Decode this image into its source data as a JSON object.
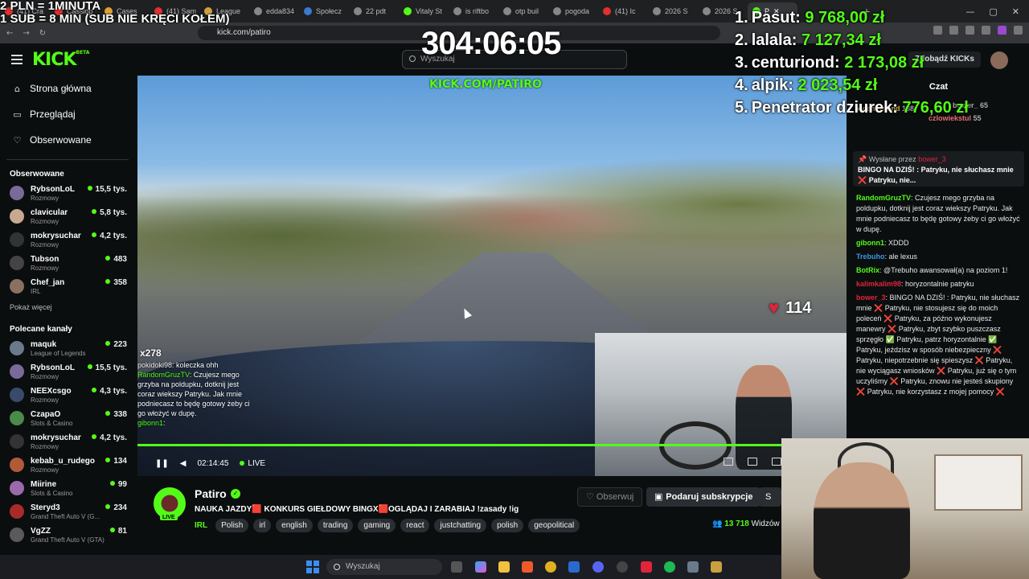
{
  "browser": {
    "tabs": [
      {
        "title": "(41) Cra",
        "color": "#e03030"
      },
      {
        "title": "Cassiop",
        "color": "#e03030"
      },
      {
        "title": "Cases",
        "color": "#e0a030"
      },
      {
        "title": "(41) Sam",
        "color": "#e03030"
      },
      {
        "title": "League",
        "color": "#d0a040"
      },
      {
        "title": "edda834",
        "color": "#888888"
      },
      {
        "title": "Społecz",
        "color": "#3a7ad0"
      },
      {
        "title": "22 pdt",
        "color": "#888888"
      },
      {
        "title": "Vitaly St",
        "color": "#53fc18"
      },
      {
        "title": "is riftbo",
        "color": "#888888"
      },
      {
        "title": "otp buil",
        "color": "#888888"
      },
      {
        "title": "pogoda",
        "color": "#888888"
      },
      {
        "title": "(41) Ic",
        "color": "#e03030"
      },
      {
        "title": "2026 S",
        "color": "#888888"
      },
      {
        "title": "2026 S",
        "color": "#888888"
      },
      {
        "title": "P",
        "color": "#53fc18"
      }
    ],
    "url": "kick.com/patiro",
    "window_controls": {
      "minimize": "—",
      "maximize": "▢",
      "close": "✕"
    },
    "new_tab": "+",
    "close_tab": "✕"
  },
  "overlay": {
    "line1": "2 PLN =  1MINUTA",
    "line2": "1 SUB = 8 MIN (SUB NIE KRĘCI KOŁEM)",
    "timer": "304:06:05",
    "leaderboard": [
      {
        "rank": "1.",
        "name": "Pasut:",
        "amount": "9 768,00 zł"
      },
      {
        "rank": "2.",
        "name": "lalala:",
        "amount": "7 127,34 zł"
      },
      {
        "rank": "3.",
        "name": "centuriond:",
        "amount": "2 173,08 zł"
      },
      {
        "rank": "4.",
        "name": "alpik:",
        "amount": "2 023,54 zł"
      },
      {
        "rank": "5.",
        "name": "Penetrator dziurek:",
        "amount": "776,60 zł"
      }
    ]
  },
  "header": {
    "logo": "KICK",
    "logo_badge": "BETA",
    "search_placeholder": "Wyszukaj",
    "kicks_button": "Zdobądź KICKs"
  },
  "sidebar": {
    "nav": [
      {
        "label": "Strona główna",
        "icon": "home-icon",
        "glyph": "⌂"
      },
      {
        "label": "Przeglądaj",
        "icon": "browse-icon",
        "glyph": "▭"
      },
      {
        "label": "Obserwowane",
        "icon": "heart-icon",
        "glyph": "♡"
      }
    ],
    "followed_title": "Obserwowane",
    "followed": [
      {
        "name": "RybsonLoL",
        "category": "Rozmowy",
        "viewers": "15,5 tys.",
        "color": "#7a6a9a"
      },
      {
        "name": "clavicular",
        "category": "Rozmowy",
        "viewers": "5,8 tys.",
        "color": "#c8a890"
      },
      {
        "name": "mokrysuchar",
        "category": "Rozmowy",
        "viewers": "4,2 tys.",
        "color": "#333333"
      },
      {
        "name": "Tubson",
        "category": "Rozmowy",
        "viewers": "483",
        "color": "#444444"
      },
      {
        "name": "Chef_jan",
        "category": "IRL",
        "viewers": "358",
        "color": "#8a7060"
      }
    ],
    "show_more": "Pokaż więcej",
    "recommended_title": "Polecane kanały",
    "recommended": [
      {
        "name": "maquk",
        "category": "League of Legends",
        "viewers": "223",
        "color": "#6a7a8a"
      },
      {
        "name": "RybsonLoL",
        "category": "Rozmowy",
        "viewers": "15,5 tys.",
        "color": "#7a6a9a"
      },
      {
        "name": "NEEXcsgo",
        "category": "Rozmowy",
        "viewers": "4,3 tys.",
        "color": "#3a4a6a"
      },
      {
        "name": "CzapaO",
        "category": "Slots & Casino",
        "viewers": "338",
        "color": "#4a8a4a"
      },
      {
        "name": "mokrysuchar",
        "category": "Rozmowy",
        "viewers": "4,2 tys.",
        "color": "#333333"
      },
      {
        "name": "kebab_u_rudego",
        "category": "Rozmowy",
        "viewers": "134",
        "color": "#b05a3a"
      },
      {
        "name": "Miirine",
        "category": "Slots & Casino",
        "viewers": "99",
        "color": "#9a6aaa"
      },
      {
        "name": "Steryd3",
        "category": "Grand Theft Auto V (G...",
        "viewers": "234",
        "color": "#aa2a2a"
      },
      {
        "name": "VgZZ",
        "category": "Grand Theft Auto V (GTA)",
        "viewers": "81",
        "color": "#5a5a5a"
      }
    ]
  },
  "video": {
    "watermark": "KICK.COM/PATIRO",
    "heart_rate": "114",
    "chat_badge": "x278",
    "chat_overlay": [
      {
        "user": "pokidoki98",
        "text": ": koleczka ohh"
      },
      {
        "user": "RandomGruzTV",
        "text": ": Czujesz mego grzyba na poldupku, dotknij jest coraz wiekszy Patryku. Jak mnie podniecasz to będę gotowy żeby ci go włożyć w dupę."
      },
      {
        "user": "gibonn1",
        "text": ":"
      }
    ],
    "time": "02:14:45",
    "live_label": "LIVE",
    "progress": 1.0
  },
  "stream": {
    "name": "Patiro",
    "live_badge": "LIVE",
    "title": "NAUKA JAZDY🟥 KONKURS GIEŁDOWY BINGX🟥OGLĄDAJ I ZARABIAJ !zasady !ig",
    "category": "IRL",
    "tags": [
      "Polish",
      "irl",
      "english",
      "trading",
      "gaming",
      "react",
      "justchatting",
      "polish",
      "geopolitical"
    ],
    "follow_label": "♡ Obserwuj",
    "subscribe_label": "Podaruj subskrypcje",
    "viewers": "13 718",
    "viewers_suffix": "Widzów"
  },
  "chat": {
    "title": "Czat",
    "gifters": [
      {
        "name": "centuriond",
        "count": "188"
      },
      {
        "name": "bower_",
        "count": "65"
      },
      {
        "name": "czlowiekstul",
        "count": "55"
      }
    ],
    "pinned_by": "Wysłane przez",
    "pinned_user": "bower_3",
    "pinned_text": "BINGO NA DZIŚ! : Patryku, nie słuchasz mnie ❌ Patryku, nie...",
    "messages": [
      {
        "user": "RandomGruzTV",
        "color": "#53fc18",
        "text": ": Czujesz mego grzyba na poldupku, dotknij jest coraz wiekszy Patryku. Jak mnie podniecasz to będę gotowy żeby ci go włożyć w dupę."
      },
      {
        "user": "gibonn1",
        "color": "#53fc18",
        "text": ": XDDD"
      },
      {
        "user": "Trebuho",
        "color": "#3a9ae0",
        "text": ": ale lexus"
      },
      {
        "user": "BotRix",
        "color": "#53fc18",
        "text": ": @Trebuho awansował(a) na poziom 1!"
      },
      {
        "user": "kalimkalim98",
        "color": "#e0243a",
        "text": ": horyzontalnie patryku"
      },
      {
        "user": "bower_3",
        "color": "#e0243a",
        "text": ": BINGO NA DZIŚ! : Patryku, nie słuchasz mnie ❌ Patryku, nie stosujesz się do moich poleceń ❌ Patryku, za późno wykonujesz manewry ❌ Patryku, zbyt szybko puszczasz sprzęgło ✅ Patryku, patrz horyzontalnie ✅ Patryku, jeździsz w sposób niebezpieczny ❌ Patryku, niepotrzebnie się spieszysz ❌ Patryku, nie wyciągasz wniosków ❌ Patryku, już się o tym uczyliśmy ❌ Patryku, znowu nie jesteś skupiony ❌ Patryku, nie korzystasz z mojej pomocy ❌"
      }
    ]
  },
  "taskbar": {
    "search_placeholder": "Wyszukaj"
  }
}
